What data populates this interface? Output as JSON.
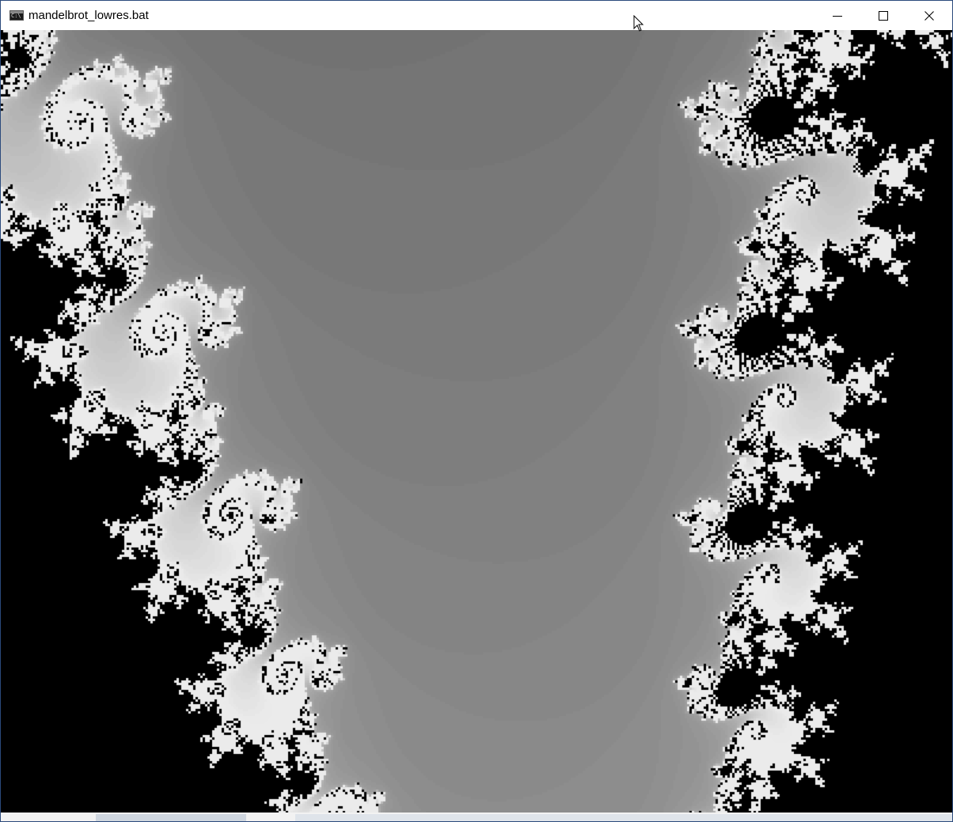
{
  "window": {
    "title": "mandelbrot_lowres.bat",
    "icon": "console-icon"
  },
  "caption_buttons": {
    "minimize_icon": "minimize-icon",
    "maximize_icon": "maximize-icon",
    "close_icon": "close-icon"
  },
  "render": {
    "fractal": "mandelbrot",
    "palette": "grayscale",
    "inside_color": "#000000"
  }
}
